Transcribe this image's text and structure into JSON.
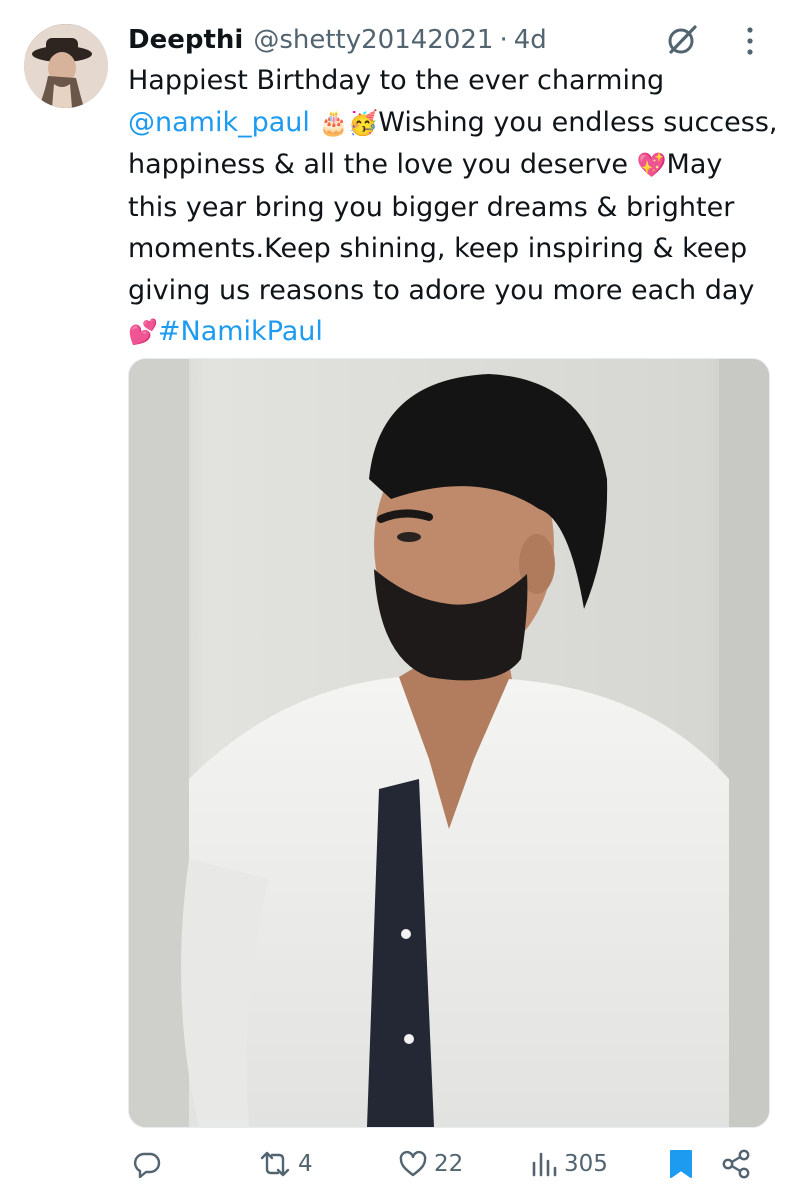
{
  "tweet": {
    "author_name": "Deepthi",
    "handle": "@shetty20142021",
    "separator": "·",
    "age": "4d",
    "text_1": "Happiest Birthday to the ever charming",
    "mention": "@namik_paul",
    "emoji_1": "🎂🥳",
    "text_2": "Wishing you endless success, happiness & all the love you deserve",
    "emoji_2": "💖",
    "text_3": "May this year bring you bigger dreams & brighter moments.Keep shining, keep inspiring & keep giving us reasons to adore you more each day",
    "emoji_3": "💕",
    "hashtag": "#NamikPaul"
  },
  "actions": {
    "reply_count": "",
    "retweet_count": "4",
    "like_count": "22",
    "views_count": "305",
    "bookmarked": true
  },
  "colors": {
    "link": "#1d9bf0",
    "muted": "#536471",
    "bookmark_active": "#1d9bf0"
  }
}
